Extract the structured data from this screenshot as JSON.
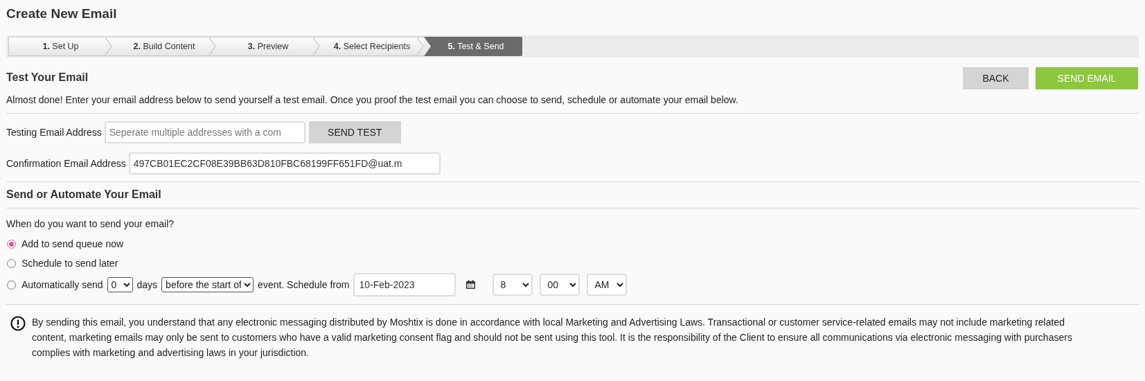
{
  "page_title": "Create New Email",
  "steps": [
    {
      "label": "**1.** Set Up",
      "selected": false
    },
    {
      "label": "**2.** Build Content",
      "selected": false
    },
    {
      "label": "**3.** Preview",
      "selected": false
    },
    {
      "label": "**4.** Select Recipients",
      "selected": false
    },
    {
      "label": "**5.** Test & Send",
      "selected": true
    }
  ],
  "test_section": {
    "heading": "Test Your Email",
    "buttons": [
      {
        "label": "BACK",
        "kind": "secondary"
      },
      {
        "label": "SEND EMAIL",
        "kind": "primary"
      }
    ],
    "intro": "Almost done! Enter your email address below to send yourself a test email. Once you proof the test email you can choose to send, schedule or automate your email below.",
    "testing_field": {
      "label": "Testing Email Address",
      "placeholder": "Seperate multiple addresses with a com",
      "button": "SEND TEST"
    },
    "confirmation_field": {
      "label": "Confirmation Email Address",
      "value": "497CB01EC2CF08E39BB63D810FBC68199FF651FD@uat.m"
    }
  },
  "send_section": {
    "heading": "Send or Automate Your Email",
    "question": "When do you want to send your email?",
    "options": [
      {
        "kind": "plain",
        "label": "Add to send queue now",
        "selected": true
      },
      {
        "kind": "plain",
        "label": "Schedule to send later",
        "selected": false
      },
      {
        "kind": "automatic",
        "label": "Automatically send",
        "selected": false,
        "days_select": "0",
        "days_label": "days",
        "timing_select": "before the start of",
        "event_label": "event. Schedule from",
        "date": "10-Feb-2023",
        "hour": "8",
        "minute": "00",
        "ampm": "AM"
      }
    ]
  },
  "notice": "By sending this email, you understand that any electronic messaging distributed by Moshtix is done in accordance with local Marketing and Advertising Laws. Transactional or customer service-related emails may not include marketing related content, marketing emails may only be sent to customers who have a valid marketing consent flag and should not be sent using this tool. It is the responsibility of the Client to ensure all communications via electronic messaging with purchasers complies with marketing and advertising laws in your jurisdiction."
}
